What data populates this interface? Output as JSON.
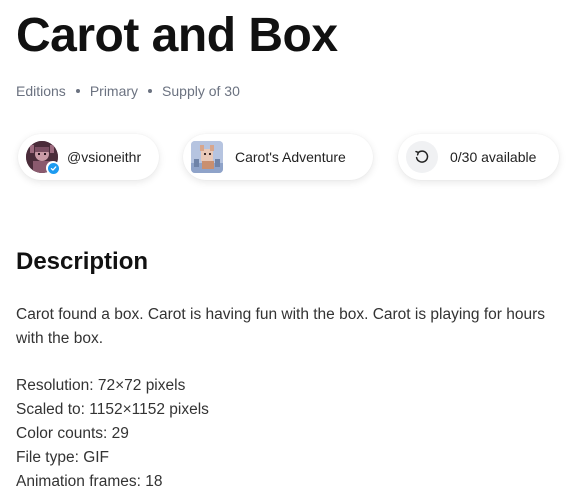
{
  "title": "Carot and Box",
  "meta": {
    "edition_type": "Editions",
    "market": "Primary",
    "supply": "Supply of 30"
  },
  "chips": {
    "creator": {
      "handle": "@vsioneithr",
      "verified": true
    },
    "collection": {
      "name": "Carot's Adventure"
    },
    "availability": {
      "text": "0/30 available",
      "available": 0,
      "total": 30
    }
  },
  "description": {
    "heading": "Description",
    "body": "Carot found a box. Carot is having fun with the box. Carot is playing for hours with the box.",
    "specs": [
      "Resolution: 72×72 pixels",
      "Scaled to: 1152×1152 pixels",
      "Color counts: 29",
      "File type: GIF",
      "Animation frames: 18"
    ]
  },
  "colors": {
    "text_primary": "#111111",
    "text_muted": "#6b7280",
    "verified_blue": "#1d9bf0"
  },
  "icons": {
    "verified": "verified-badge-icon",
    "availability": "refresh-icon"
  }
}
